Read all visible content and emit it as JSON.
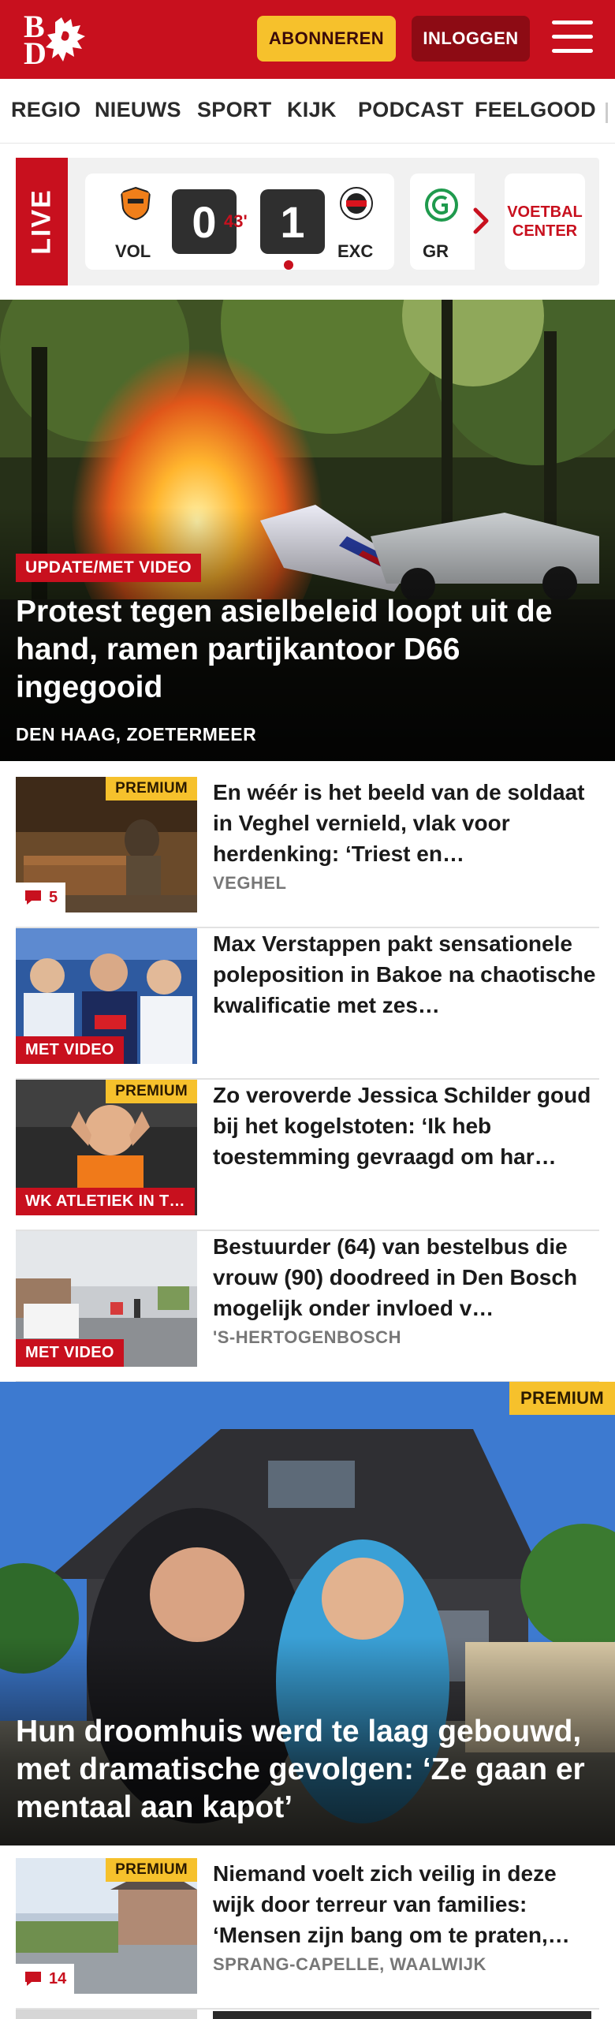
{
  "header": {
    "logo_letters": [
      "B",
      "D"
    ],
    "subscribe_label": "ABONNEREN",
    "login_label": "INLOGGEN"
  },
  "nav": {
    "items": [
      "REGIO",
      "NIEUWS",
      "SPORT",
      "KIJK",
      "PODCAST",
      "FEELGOOD"
    ]
  },
  "live": {
    "label": "LIVE",
    "match": {
      "home": "VOL",
      "away": "EXC",
      "home_score": "0",
      "away_score": "1",
      "minute": "43'"
    },
    "next_match_team": "GR",
    "voetbal_center_label": "VOETBAL CENTER"
  },
  "hero": {
    "label": "UPDATE/MET VIDEO",
    "title": "Protest tegen asielbeleid loopt uit de hand, ramen partijkantoor D66 ingegooid",
    "location": "DEN HAAG, ZOETERMEER"
  },
  "articles": [
    {
      "premium": "PREMIUM",
      "comments": "5",
      "title": "En wéér is het beeld van de soldaat in Veghel vernield, vlak voor herdenking: ‘Triest en…",
      "location": "VEGHEL"
    },
    {
      "tag": "MET VIDEO",
      "title": "Max Verstappen pakt sensatione­le poleposition in Bakoe na chaotische kwalificatie met zes…"
    },
    {
      "premium": "PREMIUM",
      "tag": "WK ATLETIEK IN T…",
      "title": "Zo veroverde Jessica Schilder goud bij het kogelstoten: ‘Ik heb toestemming gevraagd om har…"
    },
    {
      "tag": "MET VIDEO",
      "title": "Bestuurder (64) van bestelbus die vrouw (90) doodreed in Den Bosch mogelijk onder invloed v…",
      "location": "'S-HERTOGENBOSCH"
    }
  ],
  "feature": {
    "premium": "PREMIUM",
    "title": "Hun droomhuis werd te laag gebouwd, met dramatische gevolgen: ‘Ze gaan er mentaal aan kapot’"
  },
  "article_bottom": {
    "premium": "PREMIUM",
    "comments": "14",
    "title": "Niemand voelt zich veilig in deze wijk door terreur van families: ‘Mensen zijn bang om te praten,…",
    "location": "SPRANG-CAPELLE, WAALWIJK"
  },
  "colors": {
    "brand_red": "#c8101e",
    "premium_yellow": "#f6c12c",
    "login_dark_red": "#8d0b14"
  }
}
